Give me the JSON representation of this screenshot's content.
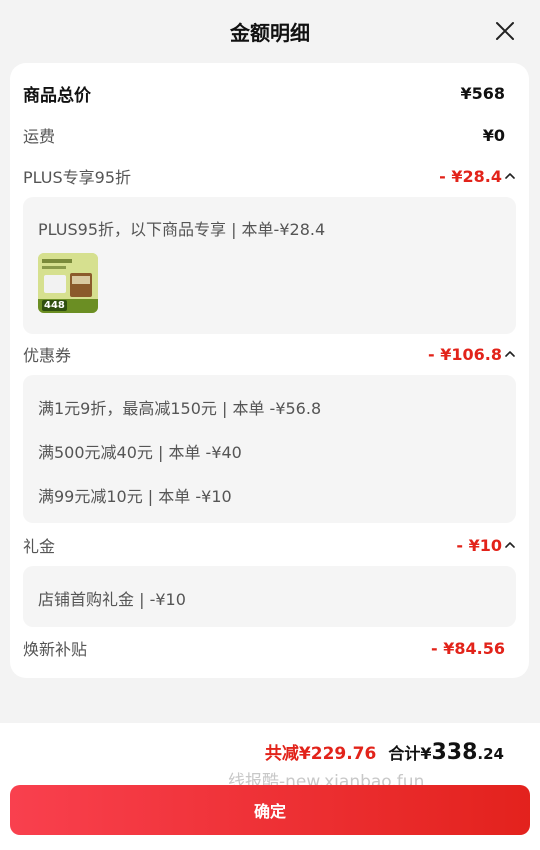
{
  "header": {
    "title": "金额明细"
  },
  "rows": {
    "goods_total": {
      "label": "商品总价",
      "value": "¥568"
    },
    "shipping": {
      "label": "运费",
      "value": "¥0"
    },
    "plus": {
      "label": "PLUS专享95折",
      "value": "- ¥28.4"
    },
    "coupon": {
      "label": "优惠券",
      "value": "- ¥106.8"
    },
    "gift": {
      "label": "礼金",
      "value": "- ¥10"
    },
    "subsidy": {
      "label": "焕新补贴",
      "value": "- ¥84.56"
    }
  },
  "plus_detail": {
    "text": "PLUS95折，以下商品专享 | 本单-¥28.4",
    "thumb_badge": "448"
  },
  "coupon_detail": [
    "满1元9折，最高减150元 | 本单 -¥56.8",
    "满500元减40元 | 本单 -¥40",
    "满99元减10元 | 本单 -¥10"
  ],
  "gift_detail": {
    "text": "店铺首购礼金 | -¥10"
  },
  "summary": {
    "saved": "共减¥229.76",
    "total_label": "合计¥",
    "total_int": "338",
    "total_dec": ".24"
  },
  "watermark": "线报酷-new.xianbao.fun",
  "confirm_label": "确定",
  "colors": {
    "accent_red": "#e2231a",
    "button_start": "#f9404e",
    "button_end": "#e3221d"
  }
}
